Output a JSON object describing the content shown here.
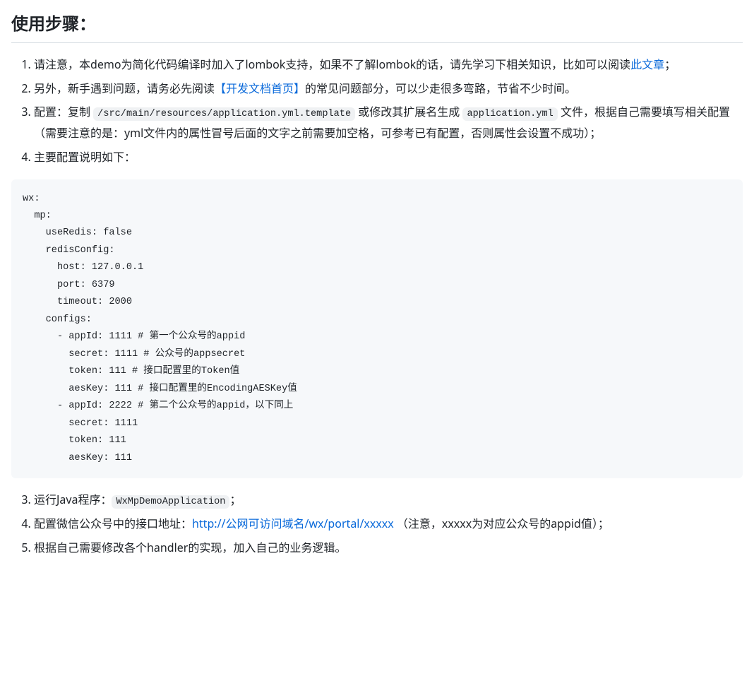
{
  "heading": "使用步骤：",
  "list1": {
    "item1": {
      "t1": "请注意，本demo为简化代码编译时加入了lombok支持，如果不了解lombok的话，请先学习下相关知识，比如可以阅读",
      "link": "此文章",
      "t2": "；"
    },
    "item2": {
      "t1": "另外，新手遇到问题，请务必先阅读",
      "link": "【开发文档首页】",
      "t2": "的常见问题部分，可以少走很多弯路，节省不少时间。"
    },
    "item3": {
      "t1": "配置：复制 ",
      "code1": "/src/main/resources/application.yml.template",
      "t2": " 或修改其扩展名生成 ",
      "code2": "application.yml",
      "t3": " 文件，根据自己需要填写相关配置（需要注意的是：yml文件内的属性冒号后面的文字之前需要加空格，可参考已有配置，否则属性会设置不成功）；"
    },
    "item4": {
      "t1": "主要配置说明如下："
    }
  },
  "codeblock": "wx:\n  mp:\n    useRedis: false\n    redisConfig:\n      host: 127.0.0.1\n      port: 6379\n      timeout: 2000\n    configs:\n      - appId: 1111 # 第一个公众号的appid\n        secret: 1111 # 公众号的appsecret\n        token: 111 # 接口配置里的Token值\n        aesKey: 111 # 接口配置里的EncodingAESKey值\n      - appId: 2222 # 第二个公众号的appid，以下同上\n        secret: 1111\n        token: 111\n        aesKey: 111\n",
  "list2": {
    "item3": {
      "t1": "运行Java程序：",
      "code1": "WxMpDemoApplication",
      "t2": "；"
    },
    "item4": {
      "t1": "配置微信公众号中的接口地址：",
      "link": "http://公网可访问域名/wx/portal/xxxxx",
      "t2": " （注意，xxxxx为对应公众号的appid值）；"
    },
    "item5": {
      "t1": "根据自己需要修改各个handler的实现，加入自己的业务逻辑。"
    }
  }
}
